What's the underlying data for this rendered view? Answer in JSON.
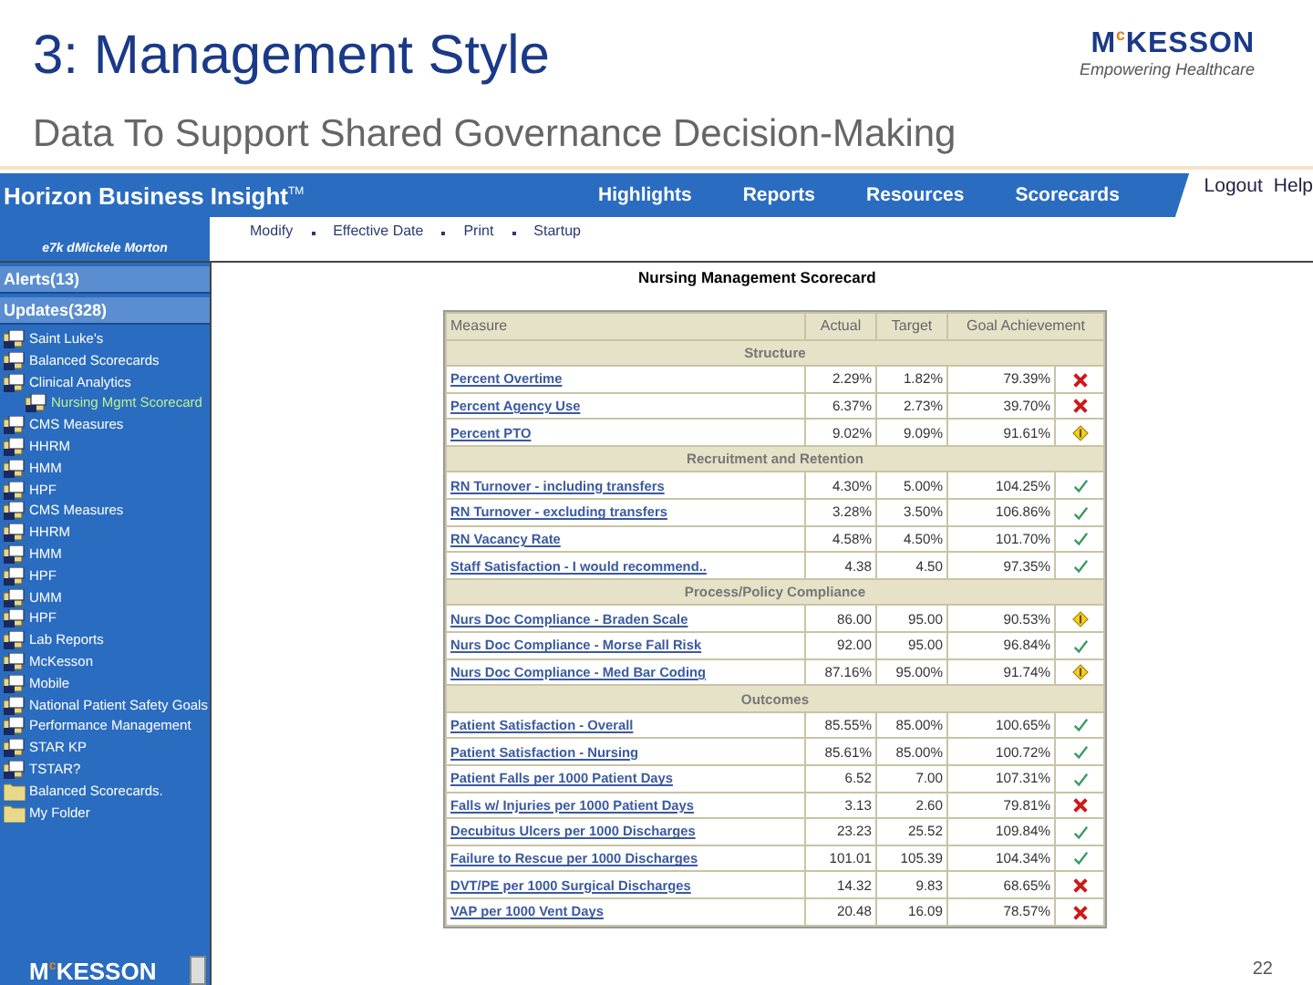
{
  "slide": {
    "title": "3: Management Style",
    "subtitle": "Data To Support Shared Governance Decision-Making",
    "logo": "M$^{c}$KESSON",
    "tagline": "Empowering Healthcare",
    "page_number": "22"
  },
  "app": {
    "title": "Horizon Business Insight",
    "trademark": "TM",
    "user": "e7k dMickele Morton",
    "nav": [
      "Highlights",
      "Reports",
      "Resources",
      "Scorecards"
    ],
    "account_links": [
      "Logout",
      "Help"
    ],
    "subnav": [
      "Modify",
      "Effective Date",
      "Print",
      "Startup"
    ],
    "sidebar": {
      "panels": [
        "Alerts(13)",
        "Updates(328)"
      ],
      "tree": [
        {
          "label": "Saint Luke's",
          "kind": "report",
          "selected": false
        },
        {
          "label": "Balanced Scorecards",
          "kind": "report",
          "selected": false
        },
        {
          "label": "Clinical Analytics",
          "kind": "report",
          "selected": false,
          "children": [
            {
              "label": "Nursing Mgmt Scorecard",
              "kind": "report",
              "selected": true
            }
          ]
        },
        {
          "label": "CMS Measures",
          "kind": "report",
          "selected": false
        },
        {
          "label": "HHRM",
          "kind": "report",
          "selected": false
        },
        {
          "label": "HMM",
          "kind": "report",
          "selected": false
        },
        {
          "label": "HPF",
          "kind": "report",
          "selected": false
        },
        {
          "label": "CMS Measures",
          "kind": "report",
          "selected": false
        },
        {
          "label": "HHRM",
          "kind": "report",
          "selected": false
        },
        {
          "label": "HMM",
          "kind": "report",
          "selected": false
        },
        {
          "label": "HPF",
          "kind": "report",
          "selected": false
        },
        {
          "label": "UMM",
          "kind": "report",
          "selected": false
        },
        {
          "label": "HPF",
          "kind": "report",
          "selected": false
        },
        {
          "label": "Lab Reports",
          "kind": "report",
          "selected": false
        },
        {
          "label": "McKesson",
          "kind": "report",
          "selected": false
        },
        {
          "label": "Mobile",
          "kind": "report",
          "selected": false
        },
        {
          "label": "National Patient Safety Goals",
          "kind": "report",
          "selected": false
        },
        {
          "label": "Performance Management",
          "kind": "report",
          "selected": false
        },
        {
          "label": "STAR KP",
          "kind": "report",
          "selected": false
        },
        {
          "label": "TSTAR?",
          "kind": "report",
          "selected": false
        },
        {
          "label": "Balanced Scorecards.",
          "kind": "folder",
          "selected": false
        },
        {
          "label": "My Folder",
          "kind": "folder",
          "selected": false
        }
      ],
      "logo": "M$^{c}$KESSON"
    },
    "scorecard": {
      "title": "Nursing Management Scorecard",
      "columns": [
        "Measure",
        "Actual",
        "Target",
        "Goal Achievement"
      ],
      "sections": [
        {
          "name": "Structure",
          "rows": [
            {
              "measure": "Percent Overtime",
              "actual": "2.29%",
              "target": "1.82%",
              "achievement": "79.39%",
              "kind": "fail"
            },
            {
              "measure": "Percent Agency Use",
              "actual": "6.37%",
              "target": "2.73%",
              "achievement": "39.70%",
              "kind": "fail"
            },
            {
              "measure": "Percent PTO",
              "actual": "9.02%",
              "target": "9.09%",
              "achievement": "91.61%",
              "kind": "warn"
            }
          ]
        },
        {
          "name": "Recruitment and Retention",
          "rows": [
            {
              "measure": "RN Turnover - including transfers",
              "actual": "4.30%",
              "target": "5.00%",
              "achievement": "104.25%",
              "kind": "pass"
            },
            {
              "measure": "RN Turnover - excluding transfers",
              "actual": "3.28%",
              "target": "3.50%",
              "achievement": "106.86%",
              "kind": "pass"
            },
            {
              "measure": "RN Vacancy Rate",
              "actual": "4.58%",
              "target": "4.50%",
              "achievement": "101.70%",
              "kind": "pass"
            },
            {
              "measure": "Staff Satisfaction - I would recommend..",
              "actual": "4.38",
              "target": "4.50",
              "achievement": "97.35%",
              "kind": "pass"
            }
          ]
        },
        {
          "name": "Process/Policy Compliance",
          "rows": [
            {
              "measure": "Nurs Doc Compliance - Braden Scale",
              "actual": "86.00",
              "target": "95.00",
              "achievement": "90.53%",
              "kind": "warn"
            },
            {
              "measure": "Nurs Doc Compliance - Morse Fall Risk",
              "actual": "92.00",
              "target": "95.00",
              "achievement": "96.84%",
              "kind": "pass"
            },
            {
              "measure": "Nurs Doc Compliance - Med Bar Coding",
              "actual": "87.16%",
              "target": "95.00%",
              "achievement": "91.74%",
              "kind": "warn"
            }
          ]
        },
        {
          "name": "Outcomes",
          "rows": [
            {
              "measure": "Patient Satisfaction - Overall",
              "actual": "85.55%",
              "target": "85.00%",
              "achievement": "100.65%",
              "kind": "pass"
            },
            {
              "measure": "Patient Satisfaction - Nursing",
              "actual": "85.61%",
              "target": "85.00%",
              "achievement": "100.72%",
              "kind": "pass"
            },
            {
              "measure": "Patient Falls per 1000 Patient Days",
              "actual": "6.52",
              "target": "7.00",
              "achievement": "107.31%",
              "kind": "pass"
            },
            {
              "measure": "Falls w/ Injuries per 1000 Patient Days",
              "actual": "3.13",
              "target": "2.60",
              "achievement": "79.81%",
              "kind": "fail"
            },
            {
              "measure": "Decubitus Ulcers per 1000 Discharges",
              "actual": "23.23",
              "target": "25.52",
              "achievement": "109.84%",
              "kind": "pass"
            },
            {
              "measure": "Failure to Rescue per 1000 Discharges",
              "actual": "101.01",
              "target": "105.39",
              "achievement": "104.34%",
              "kind": "pass"
            },
            {
              "measure": "DVT/PE per 1000 Surgical Discharges",
              "actual": "14.32",
              "target": "9.83",
              "achievement": "68.65%",
              "kind": "fail"
            },
            {
              "measure": "VAP per 1000 Vent Days",
              "actual": "20.48",
              "target": "16.09",
              "achievement": "78.57%",
              "kind": "fail"
            }
          ]
        }
      ]
    }
  }
}
